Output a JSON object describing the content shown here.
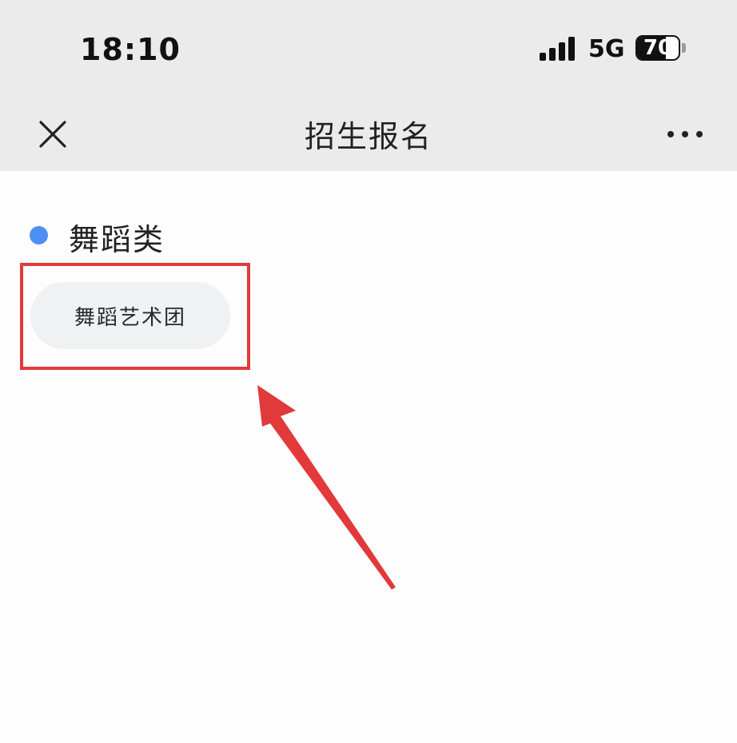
{
  "status_bar": {
    "time": "18:10",
    "network": "5G",
    "battery_level": "70",
    "battery_fraction": 0.7,
    "signal_icon": "signal-bars-icon",
    "battery_icon": "battery-icon"
  },
  "nav_bar": {
    "title": "招生报名",
    "close_icon": "close-icon",
    "more_icon": "more-dots-icon"
  },
  "section": {
    "title": "舞蹈类",
    "bullet_color": "#4d8ff2",
    "options": [
      {
        "label": "舞蹈艺术团"
      }
    ]
  },
  "annotation": {
    "color": "#e2393b",
    "highlight_icon": "highlight-box",
    "arrow_icon": "arrow-up-left-icon"
  }
}
